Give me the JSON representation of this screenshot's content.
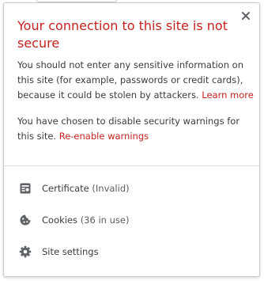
{
  "colors": {
    "title": "#c5221f",
    "link": "#c5221f",
    "body_text": "#3c3c3c",
    "icon": "#5f6368"
  },
  "header": {
    "title": "Your connection to this site is not secure",
    "close_icon": "close-icon"
  },
  "warning": {
    "text": "You should not enter any sensitive information on this site (for example, passwords or credit cards), because it could be stolen by attackers.",
    "link_label": "Learn more"
  },
  "disabled_notice": {
    "text": "You have chosen to disable security warnings for this site.",
    "link_label": "Re-enable warnings"
  },
  "menu": {
    "certificate": {
      "label": "Certificate",
      "status": "(Invalid)",
      "icon": "certificate-icon"
    },
    "cookies": {
      "label": "Cookies",
      "status": "(36 in use)",
      "icon": "cookie-icon"
    },
    "site_settings": {
      "label": "Site settings",
      "icon": "gear-icon"
    }
  }
}
